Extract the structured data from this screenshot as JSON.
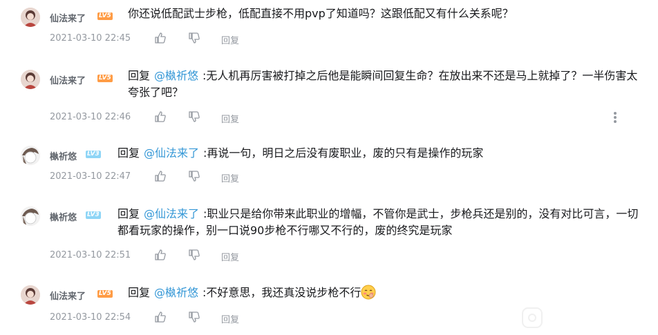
{
  "comments": [
    {
      "username": "仙法来了",
      "level": "LV5",
      "is_reply": false,
      "reply_word": "",
      "mention": "",
      "text": "你还说低配武士步枪，低配直接不用pvp了知道吗？这跟低配又有什么关系呢？",
      "time": "2021-03-10 22:45",
      "reply_label": "回复"
    },
    {
      "username": "仙法来了",
      "level": "LV5",
      "is_reply": true,
      "reply_word": "回复",
      "mention": "@槸祈悠",
      "text": ":无人机再厉害被打掉之后他是能瞬间回复生命？在放出来不还是马上就掉了？一半伤害太夸张了吧？",
      "time": "2021-03-10 22:46",
      "reply_label": "回复"
    },
    {
      "username": "槸祈悠",
      "level": "LV3",
      "is_reply": true,
      "reply_word": "回复",
      "mention": "@仙法来了",
      "text": ":再说一句，明日之后没有废职业，废的只有是操作的玩家",
      "time": "2021-03-10 22:47",
      "reply_label": "回复"
    },
    {
      "username": "槸祈悠",
      "level": "LV3",
      "is_reply": true,
      "reply_word": "回复",
      "mention": "@仙法来了",
      "text": ":职业只是给你带来此职业的增幅，不管你是武士，步枪兵还是别的，没有对比可言，一切都看玩家的操作，别一口说90步枪不行哪又不行的，废的终究是玩家",
      "time": "2021-03-10 22:51",
      "reply_label": "回复"
    },
    {
      "username": "仙法来了",
      "level": "LV5",
      "is_reply": true,
      "reply_word": "回复",
      "mention": "@槸祈悠",
      "text": ":不好意思，我还真没说步枪不行",
      "emoji": "blushing-emoji",
      "time": "2021-03-10 22:54",
      "reply_label": "回复"
    }
  ],
  "colors": {
    "mention": "#3497d6",
    "level_orange": "#ff9c45",
    "level_blue": "#8ed5f6",
    "meta_gray": "#9499a0",
    "username_gray": "#61666d"
  },
  "icons": {
    "like": "thumb-up-icon",
    "dislike": "thumb-down-icon",
    "more": "more-vertical-icon"
  }
}
